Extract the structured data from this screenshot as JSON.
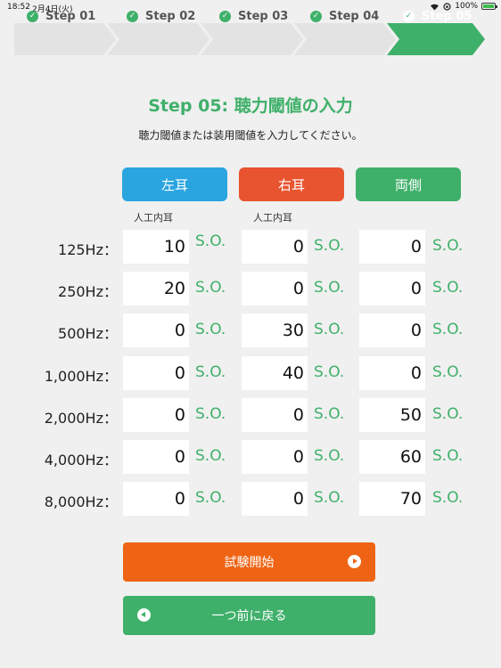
{
  "status_bar": {
    "time": "18:52",
    "date": "2月4日(火)",
    "battery": "100%"
  },
  "steps": [
    {
      "label": "Step 01",
      "active": false
    },
    {
      "label": "Step 02",
      "active": false
    },
    {
      "label": "Step 03",
      "active": false
    },
    {
      "label": "Step 04",
      "active": false
    },
    {
      "label": "Step 05",
      "active": true
    }
  ],
  "title": "Step 05: 聴力閾値の入力",
  "subtitle": "聴力閾値または装用閾値を入力してください。",
  "ears": {
    "left": "左耳",
    "right": "右耳",
    "both": "両側"
  },
  "cochlear_implant_label": "人工内耳",
  "so_label": "S.O.",
  "rows": [
    {
      "freq": "125Hz：",
      "left": "10",
      "right": "0",
      "both": "0"
    },
    {
      "freq": "250Hz：",
      "left": "20",
      "right": "0",
      "both": "0"
    },
    {
      "freq": "500Hz：",
      "left": "0",
      "right": "30",
      "both": "0"
    },
    {
      "freq": "1,000Hz：",
      "left": "0",
      "right": "40",
      "both": "0"
    },
    {
      "freq": "2,000Hz：",
      "left": "0",
      "right": "0",
      "both": "50"
    },
    {
      "freq": "4,000Hz：",
      "left": "0",
      "right": "0",
      "both": "60"
    },
    {
      "freq": "8,000Hz：",
      "left": "0",
      "right": "0",
      "both": "70"
    }
  ],
  "buttons": {
    "start": "試験開始",
    "back": "一つ前に戻る"
  },
  "colors": {
    "green": "#3fb06a",
    "blue": "#2aa5e0",
    "red": "#e8542f",
    "orange": "#ee6414"
  }
}
